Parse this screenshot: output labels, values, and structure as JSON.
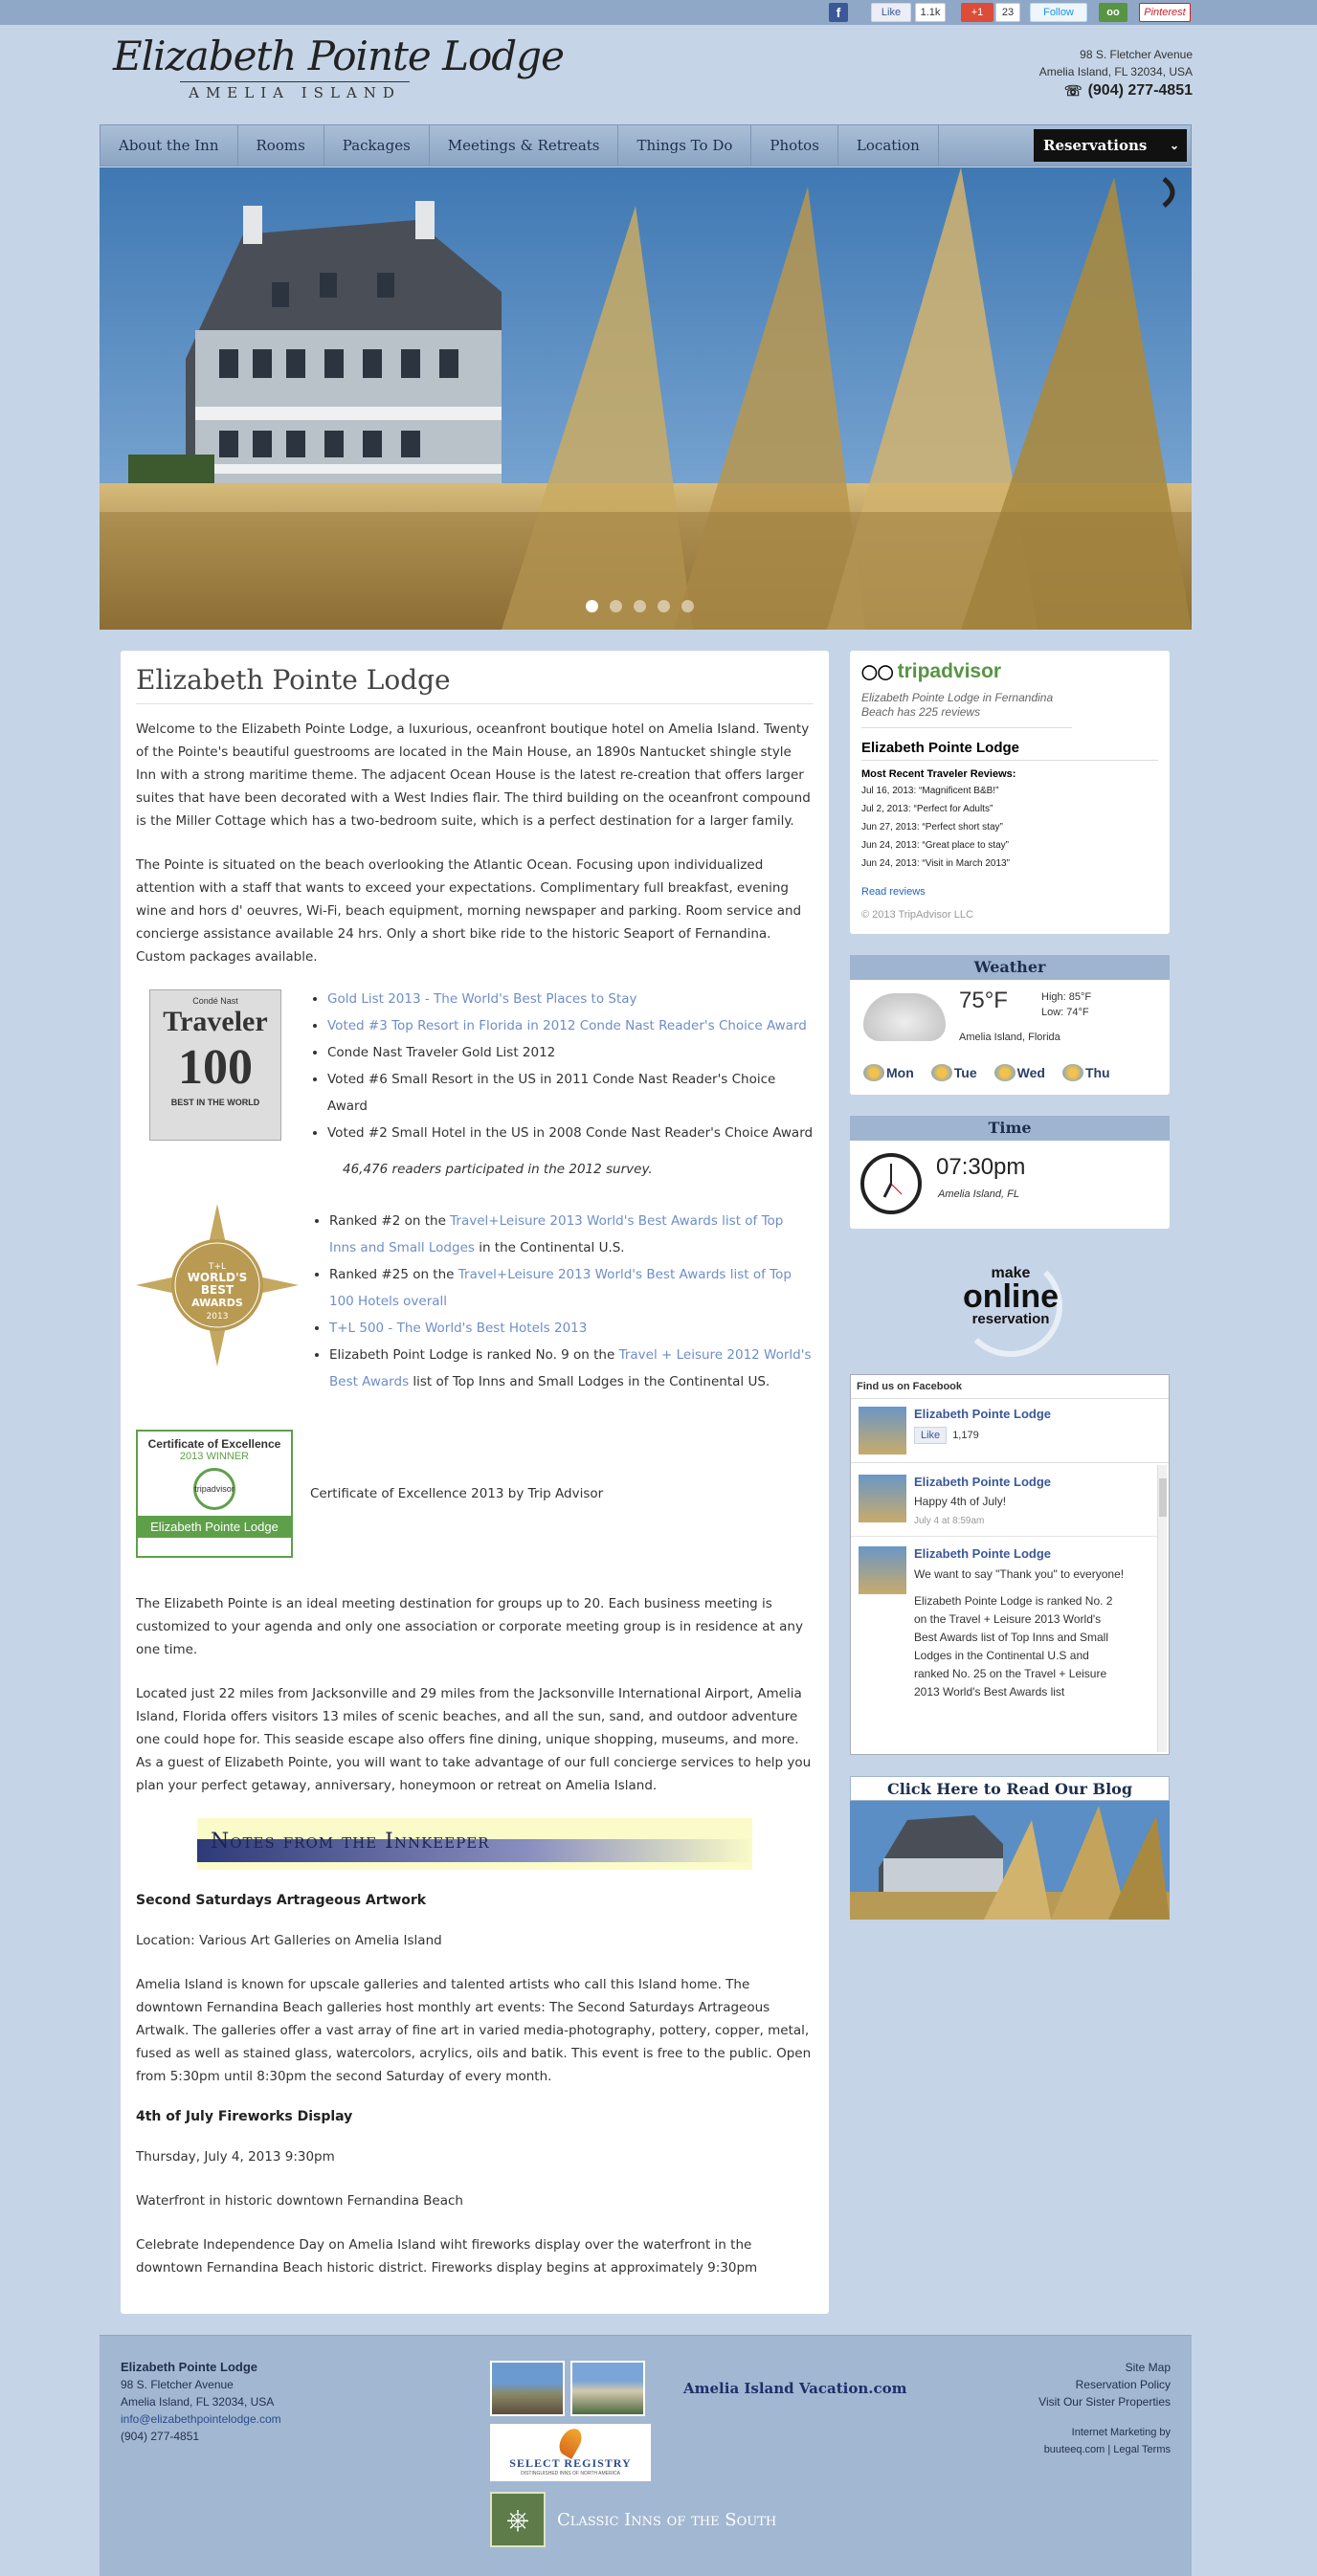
{
  "social": {
    "facebook_icon": "f",
    "like_label": "Like",
    "like_count": "1.1k",
    "gplus_label": "+1",
    "gplus_count": "23",
    "twitter_label": "Follow",
    "tripadvisor_icon": "oo",
    "pinterest_label": "Pinterest"
  },
  "header": {
    "logo_script": "Elizabeth Pointe Lodge",
    "logo_sub": "AMELIA ISLAND",
    "address_line1": "98 S. Fletcher Avenue",
    "address_line2": "Amelia Island, FL 32034, USA",
    "phone": "(904) 277-4851"
  },
  "nav": {
    "items": [
      "About the Inn",
      "Rooms",
      "Packages",
      "Meetings & Retreats",
      "Things To Do",
      "Photos",
      "Location"
    ],
    "reservations": "Reservations"
  },
  "main": {
    "title": "Elizabeth Pointe Lodge",
    "intro1": "Welcome to the Elizabeth Pointe Lodge, a luxurious, oceanfront boutique hotel on Amelia Island. Twenty of the Pointe's beautiful guestrooms are located in the Main House, an 1890s Nantucket shingle style Inn with a strong maritime theme. The adjacent Ocean House is the latest re-creation that offers larger suites that have been decorated with a West Indies flair. The third building on the oceanfront compound is the Miller Cottage which has a two-bedroom suite, which is a perfect destination for a larger family.",
    "intro2": "The Pointe is situated on the beach overlooking the Atlantic Ocean. Focusing upon individualized attention with a staff that wants to exceed your expectations. Complimentary full breakfast, evening wine and hors d' oeuvres, Wi-Fi, beach equipment, morning newspaper and parking. Room service and concierge assistance available 24 hrs. Only a short bike ride to the historic Seaport of Fernandina. Custom packages available.",
    "traveler_badge": {
      "top": "Condé Nast",
      "name": "Traveler",
      "number": "100",
      "bottom": "BEST IN THE WORLD"
    },
    "conde_items": [
      {
        "text": "Gold List 2013 - The World's Best Places to Stay",
        "link": true
      },
      {
        "text": "Voted #3 Top Resort in Florida in 2012 Conde Nast Reader's Choice Award",
        "link": true
      },
      {
        "text": "Conde Nast Traveler Gold List 2012",
        "link": false
      },
      {
        "text": "Voted #6 Small Resort in the US in 2011 Conde Nast Reader's Choice Award",
        "link": false
      },
      {
        "text": "Voted #2 Small Hotel in the US in 2008 Conde Nast Reader's Choice Award",
        "link": false
      }
    ],
    "survey_note": "46,476 readers participated in the 2012 survey.",
    "tl_badge": {
      "line1": "T+L",
      "line2": "WORLD'S",
      "line3": "BEST",
      "line4": "AWARDS",
      "line5": "2013"
    },
    "tl1_pre": "Ranked #2 on the ",
    "tl1_link": "Travel+Leisure 2013 World's Best Awards list of Top Inns and Small Lodges",
    "tl1_post": " in the Continental U.S.",
    "tl2_pre": "Ranked #25 on the ",
    "tl2_link": "Travel+Leisure 2013 World's Best Awards list of Top 100 Hotels overall",
    "tl3_link": "T+L 500 - The World's Best Hotels 2013",
    "tl4_pre": "Elizabeth Point Lodge is ranked No. 9 on the ",
    "tl4_link": "Travel + Leisure 2012 World's Best Awards",
    "tl4_post": " list of Top Inns and Small Lodges in the Continental US.",
    "coe_badge": {
      "title": "Certificate of Excellence",
      "winner": "2013 WINNER",
      "brand": "tripadvisor",
      "name": "Elizabeth Pointe Lodge"
    },
    "coe_text": "Certificate of Excellence 2013 by Trip Advisor",
    "meeting": "The Elizabeth Pointe is an ideal meeting destination for groups up to 20. Each business meeting is customized to your agenda and only one association or corporate meeting group is in residence at any one time.",
    "located": "Located just 22 miles from Jacksonville and 29 miles from the Jacksonville International Airport, Amelia Island, Florida offers visitors 13 miles of scenic beaches, and all the sun, sand, and outdoor adventure one could hope for. This seaside escape also offers fine dining, unique shopping, museums, and more. As a guest of Elizabeth Pointe, you will want to take advantage of our full concierge services to help you plan your perfect getaway, anniversary, honeymoon or retreat on Amelia Island.",
    "notes_banner": "Notes from the Innkeeper",
    "event1_title": "Second Saturdays Artrageous Artwork",
    "event1_location": "Location: Various Art Galleries on Amelia Island",
    "event1_body": "Amelia Island is known for upscale galleries and talented artists who call this Island home. The downtown Fernandina Beach galleries host monthly art events: The Second Saturdays Artrageous Artwalk. The galleries offer a vast array of fine art in varied media-photography, pottery, copper, metal, fused as well as stained glass, watercolors, acrylics, oils and batik. This event is free to the public. Open from 5:30pm until 8:30pm the second Saturday of every month.",
    "event2_title": "4th of July Fireworks Display",
    "event2_date": "Thursday, July 4, 2013 9:30pm",
    "event2_place": "Waterfront in historic downtown Fernandina Beach",
    "event2_body": "Celebrate Independence Day on Amelia Island wiht fireworks display over the waterfront in the downtown Fernandina Beach historic district. Fireworks display begins at approximately 9:30pm"
  },
  "tripadvisor": {
    "logo_text": "tripadvisor",
    "subtitle": "Elizabeth Pointe Lodge in Fernandina Beach has 225 reviews",
    "name": "Elizabeth Pointe Lodge",
    "reviews_title": "Most Recent Traveler Reviews:",
    "reviews": [
      "Jul 16, 2013: “Magnificent B&B!”",
      "Jul 2, 2013: “Perfect for Adults”",
      "Jun 27, 2013: “Perfect short stay”",
      "Jun 24, 2013: “Great place to stay”",
      "Jun 24, 2013: “Visit in March 2013”"
    ],
    "read_reviews": "Read reviews",
    "copyright": "© 2013 TripAdvisor LLC"
  },
  "weather": {
    "heading": "Weather",
    "temp": "75°F",
    "high": "High: 85°F",
    "low": "Low: 74°F",
    "location": "Amelia Island, Florida",
    "days": [
      "Mon",
      "Tue",
      "Wed",
      "Thu"
    ]
  },
  "time": {
    "heading": "Time",
    "value": "07:30pm",
    "location": "Amelia Island, FL"
  },
  "make_online": {
    "line1": "make",
    "line2": "online",
    "line3": "reservation"
  },
  "facebook": {
    "heading": "Find us on Facebook",
    "page_name": "Elizabeth Pointe Lodge",
    "like_label": "Like",
    "like_count": "1,179",
    "posts": [
      {
        "author": "Elizabeth Pointe Lodge",
        "text": "Happy 4th of July!",
        "meta": "July 4 at 8:59am"
      },
      {
        "author": "Elizabeth Pointe Lodge",
        "text": "We want to say \"Thank you\" to everyone!",
        "more": "Elizabeth Pointe Lodge is ranked No. 2 on the Travel + Leisure 2013 World's Best Awards list of Top Inns and Small Lodges in the Continental U.S and ranked No. 25 on the Travel + Leisure 2013 World's Best Awards list"
      }
    ]
  },
  "blog": {
    "heading": "Click Here to Read Our Blog"
  },
  "footer": {
    "name": "Elizabeth Pointe Lodge",
    "address1": "98 S. Fletcher Avenue",
    "address2": "Amelia Island, FL 32034, USA",
    "email": "info@elizabethpointelodge.com",
    "phone": "(904) 277-4851",
    "vacation": "Amelia Island Vacation.com",
    "select_registry": "SELECT REGISTRY",
    "select_tag": "DISTINGUISHED INNS OF NORTH AMERICA",
    "classic_inns": "Classic Inns of the South",
    "links": [
      "Site Map",
      "Reservation Policy",
      "Visit Our Sister Properties"
    ],
    "marketing1": "Internet Marketing by",
    "marketing2_a": "buuteeq.com",
    "marketing2_sep": " | ",
    "marketing2_b": "Legal Terms"
  },
  "colors": {
    "accent": "#1e2f4d",
    "link": "#6e8ec7",
    "page_bg": "#c5d5e7",
    "panel": "#9fb4cf"
  }
}
